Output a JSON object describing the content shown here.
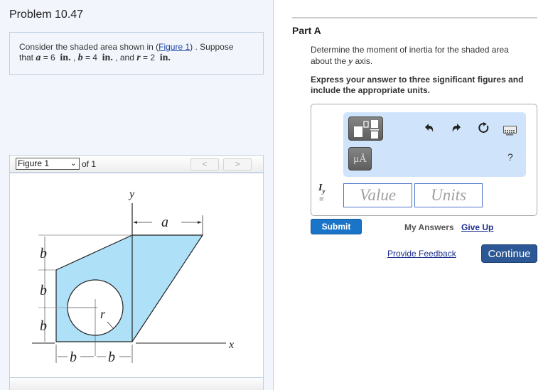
{
  "problem": {
    "title": "Problem 10.47",
    "text_before_link": "Consider the shaded area shown in (",
    "figure_link": "Figure 1",
    "text_after_link": ") . Suppose",
    "line2_prefix": "that ",
    "vars": [
      {
        "name": "a",
        "value": "6",
        "unit": "in."
      },
      {
        "name": "b",
        "value": "4",
        "unit": "in."
      },
      {
        "name": "r",
        "value": "2",
        "unit": "in."
      }
    ],
    "and_word": "and"
  },
  "figure": {
    "selected": "Figure 1",
    "of_label": "of 1",
    "prev_label": "<",
    "next_label": ">",
    "labels": {
      "y": "y",
      "x": "x",
      "a": "a",
      "b": "b",
      "r": "r"
    },
    "fill_color": "#aee0f8"
  },
  "partA": {
    "title": "Part A",
    "question_1": "Determine the moment of inertia for the shaded area",
    "question_2_prefix": "about the ",
    "question_var": "y",
    "question_2_suffix": " axis.",
    "instruction": "Express your answer to three significant figures and include the appropriate units.",
    "toolbar": {
      "templates_icon": "templates-icon",
      "units_label": "μÅ",
      "undo_icon": "undo-icon",
      "redo_icon": "redo-icon",
      "reset_icon": "reset-icon",
      "keyboard_icon": "keyboard-icon",
      "help_label": "?"
    },
    "answer_label_main": "I",
    "answer_label_sub": "y",
    "equals": "=",
    "value_placeholder": "Value",
    "units_placeholder": "Units",
    "submit": "Submit",
    "my_answers": "My Answers",
    "give_up": "Give Up",
    "feedback": "Provide Feedback",
    "continue": "Continue"
  }
}
